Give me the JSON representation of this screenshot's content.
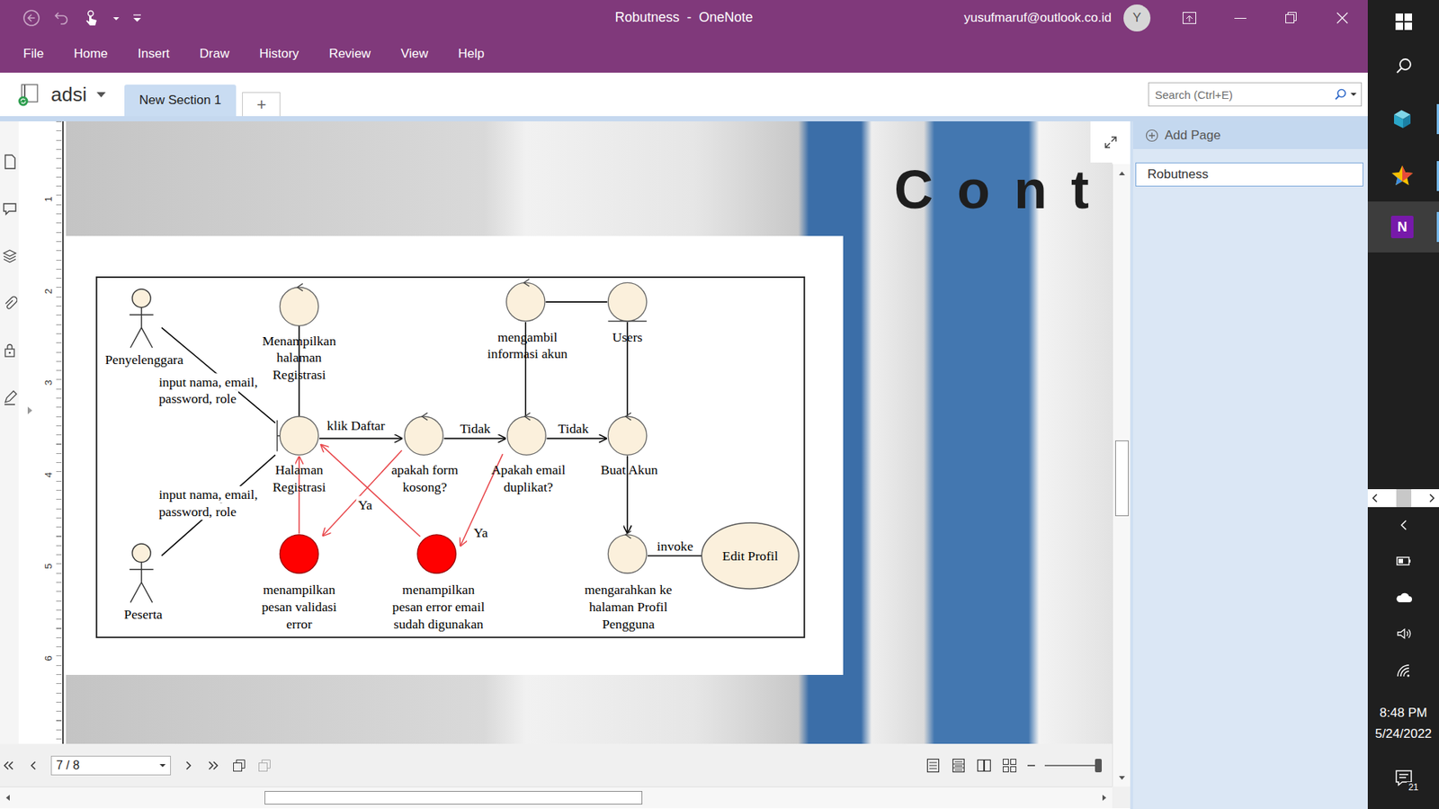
{
  "window": {
    "title": "Robutness  -  OneNote",
    "account": "yusufmaruf@outlook.co.id",
    "avatar": "Y"
  },
  "menu": [
    "File",
    "Home",
    "Insert",
    "Draw",
    "History",
    "Review",
    "View",
    "Help"
  ],
  "notebook": {
    "name": "adsi"
  },
  "sections": [
    {
      "label": "New Section 1",
      "selected": true
    }
  ],
  "add_section": "+",
  "search": {
    "placeholder": "Search (Ctrl+E)"
  },
  "ruler": [
    "1",
    "2",
    "3",
    "4",
    "5",
    "6"
  ],
  "slide": {
    "heading": "C o n t"
  },
  "figure": {
    "nodes": [
      {
        "kind": "actor",
        "lines": [
          "Penyelenggara"
        ],
        "color": "#fbf0dc"
      },
      {
        "kind": "actor",
        "lines": [
          "Peserta"
        ],
        "color": "#fbf0dc"
      },
      {
        "kind": "control",
        "lines": [
          "Menampilkan",
          "halaman",
          "Registrasi"
        ],
        "color": "#fbf0dc"
      },
      {
        "kind": "boundary",
        "lines": [
          "Halaman",
          "Registrasi"
        ],
        "color": "#fbf0dc"
      },
      {
        "kind": "control",
        "lines": [
          "apakah form",
          "kosong?"
        ],
        "color": "#fbf0dc"
      },
      {
        "kind": "control",
        "lines": [
          "Apakah email",
          "duplikat?"
        ],
        "color": "#fbf0dc"
      },
      {
        "kind": "control",
        "lines": [
          "Buat Akun"
        ],
        "color": "#fbf0dc"
      },
      {
        "kind": "control",
        "lines": [
          "mengambil",
          "informasi akun"
        ],
        "color": "#fbf0dc"
      },
      {
        "kind": "entity",
        "lines": [
          "Users"
        ],
        "color": "#fbf0dc"
      },
      {
        "kind": "error",
        "lines": [
          "menampilkan",
          "pesan validasi",
          "error"
        ],
        "color": "#ff0000"
      },
      {
        "kind": "error",
        "lines": [
          "menampilkan",
          "pesan error email",
          "sudah digunakan"
        ],
        "color": "#ff0000"
      },
      {
        "kind": "control",
        "lines": [
          "mengarahkan ke",
          "halaman Profil",
          "Pengguna"
        ],
        "color": "#fbf0dc"
      },
      {
        "kind": "usecase",
        "lines": [
          "Edit Profil"
        ],
        "color": "#fbf0dc"
      }
    ],
    "edges": [
      {
        "from": 0,
        "to": 3,
        "arrow": false,
        "color": "#000000",
        "label": [
          "input nama, email,",
          "password, role"
        ]
      },
      {
        "from": 1,
        "to": 3,
        "arrow": false,
        "color": "#000000",
        "label": [
          "input nama, email,",
          "password, role"
        ]
      },
      {
        "from": 2,
        "to": 3,
        "arrow": false,
        "color": "#000000",
        "label": []
      },
      {
        "from": 3,
        "to": 4,
        "arrow": true,
        "color": "#000000",
        "label": [
          "klik Daftar"
        ]
      },
      {
        "from": 4,
        "to": 5,
        "arrow": true,
        "color": "#000000",
        "label": [
          "Tidak"
        ]
      },
      {
        "from": 5,
        "to": 6,
        "arrow": true,
        "color": "#000000",
        "label": [
          "Tidak"
        ]
      },
      {
        "from": 7,
        "to": 8,
        "arrow": false,
        "color": "#000000",
        "label": []
      },
      {
        "from": 7,
        "to": 5,
        "arrow": false,
        "color": "#000000",
        "label": []
      },
      {
        "from": 8,
        "to": 6,
        "arrow": false,
        "color": "#000000",
        "label": []
      },
      {
        "from": 6,
        "to": 11,
        "arrow": true,
        "color": "#000000",
        "label": []
      },
      {
        "from": 11,
        "to": 12,
        "arrow": false,
        "color": "#000000",
        "label": [
          "invoke"
        ]
      },
      {
        "from": 4,
        "to": 9,
        "arrow": true,
        "color": "#e8474b",
        "label": [
          "Ya"
        ]
      },
      {
        "from": 9,
        "to": 3,
        "arrow": true,
        "color": "#e8474b",
        "label": []
      },
      {
        "from": 5,
        "to": 10,
        "arrow": true,
        "color": "#e8474b",
        "label": [
          "Ya"
        ]
      },
      {
        "from": 10,
        "to": 3,
        "arrow": true,
        "color": "#e8474b",
        "label": []
      }
    ]
  },
  "printout": {
    "page": "7 / 8",
    "zoom": {
      "level": 0.95
    }
  },
  "scrollbars": {
    "vertical": {
      "start": 0.44,
      "size": 0.13
    },
    "horizontal": {
      "start": 0.23,
      "size": 0.35
    }
  },
  "pages_panel": {
    "add_page": "Add Page",
    "pages": [
      {
        "label": "Robutness",
        "selected": true
      }
    ]
  },
  "taskbar": {
    "apps": [
      {
        "kind": "paint3d",
        "running": true,
        "active": false
      },
      {
        "kind": "favorites",
        "running": true,
        "active": false
      },
      {
        "kind": "onenote",
        "running": true,
        "active": true,
        "logo": "N"
      }
    ],
    "time": "8:48 PM",
    "date": "5/24/2022",
    "notifications": "21"
  }
}
